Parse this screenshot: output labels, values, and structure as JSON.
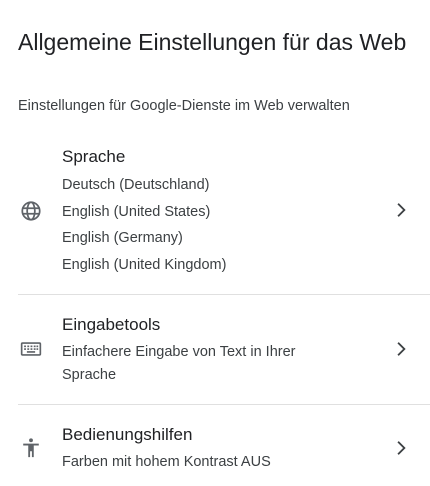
{
  "page": {
    "title": "Allgemeine Einstellungen für das Web",
    "subtitle": "Einstellungen für Google-Dienste im Web verwalten"
  },
  "settings": [
    {
      "icon": "globe-icon",
      "label": "Sprache",
      "lines": [
        "Deutsch (Deutschland)",
        "English (United States)",
        "English (Germany)",
        "English (United Kingdom)"
      ]
    },
    {
      "icon": "keyboard-icon",
      "label": "Eingabetools",
      "description": "Einfachere Eingabe von Text in Ihrer Sprache"
    },
    {
      "icon": "accessibility-icon",
      "label": "Bedienungshilfen",
      "description": "Farben mit hohem Kontrast AUS"
    }
  ],
  "colors": {
    "text_primary": "#202124",
    "text_secondary": "#3c4043",
    "icon": "#5f6368",
    "divider": "#e0e0e0"
  }
}
